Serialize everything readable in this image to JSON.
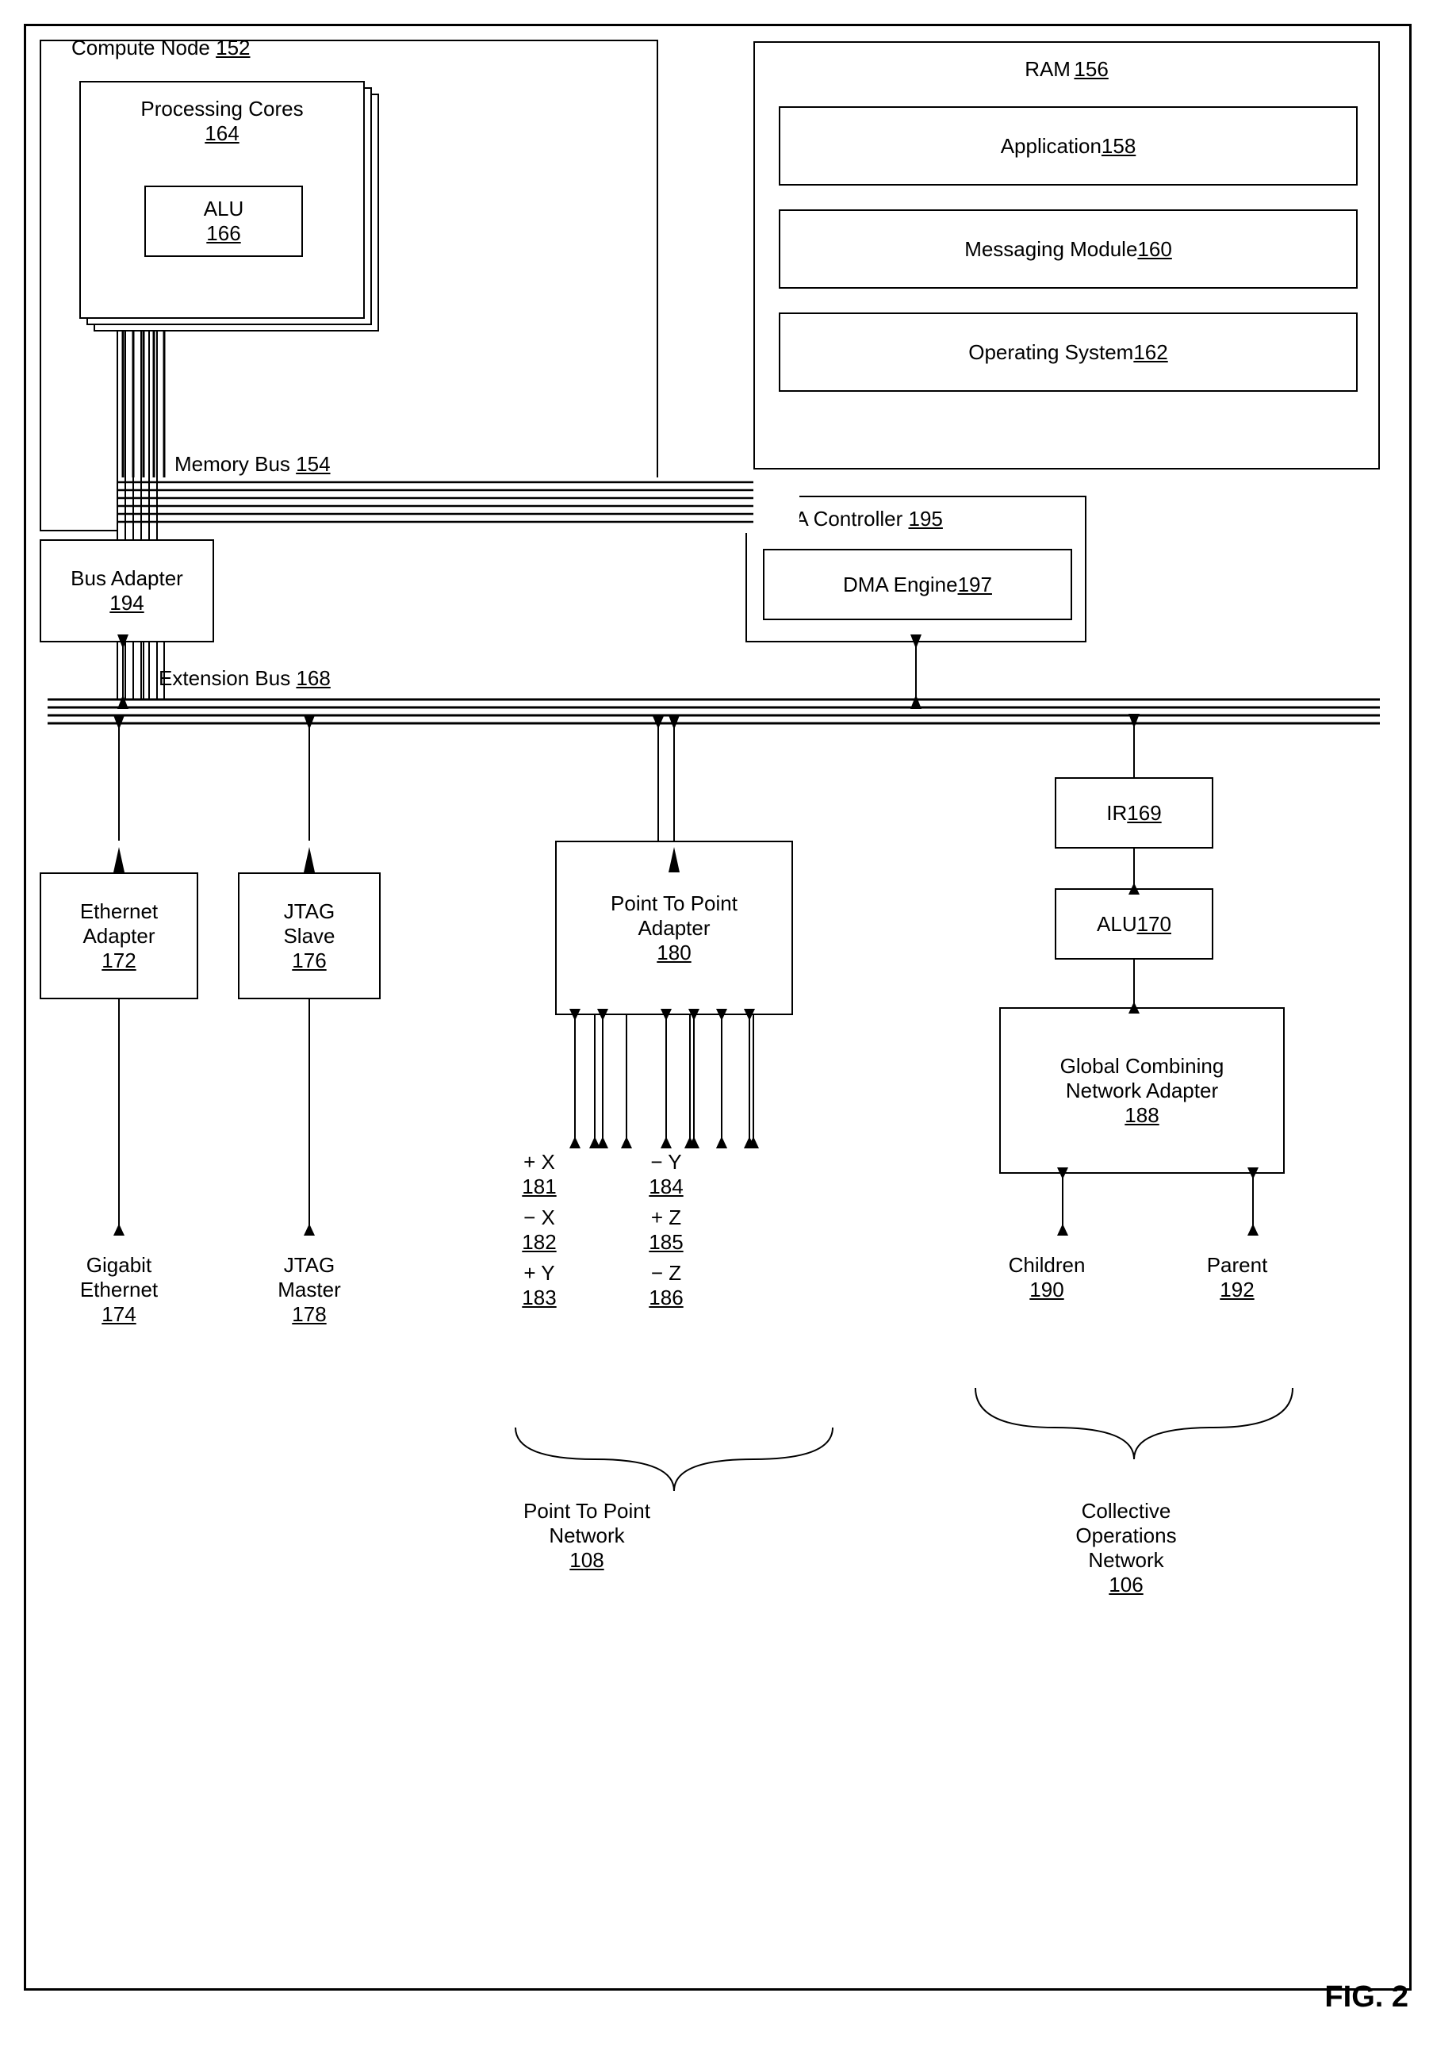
{
  "diagram": {
    "title": "FIG. 2",
    "compute_node": {
      "label": "Compute Node",
      "ref": "152",
      "processing_cores": {
        "label": "Processing Cores",
        "ref": "164",
        "alu": {
          "label": "ALU",
          "ref": "166"
        }
      },
      "memory_bus": {
        "label": "Memory Bus",
        "ref": "154"
      },
      "bus_adapter": {
        "label": "Bus Adapter",
        "ref": "194"
      }
    },
    "ram": {
      "label": "RAM",
      "ref": "156",
      "application": {
        "label": "Application",
        "ref": "158"
      },
      "messaging_module": {
        "label": "Messaging Module",
        "ref": "160"
      },
      "operating_system": {
        "label": "Operating System",
        "ref": "162"
      }
    },
    "dma_controller": {
      "label": "DMA Controller",
      "ref": "195",
      "dma_engine": {
        "label": "DMA Engine",
        "ref": "197"
      }
    },
    "extension_bus": {
      "label": "Extension Bus",
      "ref": "168"
    },
    "ethernet_adapter": {
      "label": "Ethernet Adapter",
      "ref": "172"
    },
    "jtag_slave": {
      "label": "JTAG Slave",
      "ref": "176"
    },
    "ptp_adapter": {
      "label": "Point To Point Adapter",
      "ref": "180"
    },
    "ir": {
      "label": "IR",
      "ref": "169"
    },
    "alu170": {
      "label": "ALU",
      "ref": "170"
    },
    "gcna": {
      "label": "Global Combining Network Adapter",
      "ref": "188"
    },
    "gigabit_ethernet": {
      "label": "Gigabit Ethernet",
      "ref": "174"
    },
    "jtag_master": {
      "label": "JTAG Master",
      "ref": "178"
    },
    "ptp_ports": [
      {
        "label": "+ X",
        "ref": "181"
      },
      {
        "label": "- X",
        "ref": "182"
      },
      {
        "label": "+ Y",
        "ref": "183"
      },
      {
        "label": "- Y",
        "ref": "184"
      },
      {
        "label": "+ Z",
        "ref": "185"
      },
      {
        "label": "- Z",
        "ref": "186"
      }
    ],
    "children": {
      "label": "Children",
      "ref": "190"
    },
    "parent": {
      "label": "Parent",
      "ref": "192"
    },
    "ptp_network": {
      "label": "Point To Point Network",
      "ref": "108"
    },
    "collective_ops_network": {
      "label": "Collective Operations Network",
      "ref": "106"
    }
  }
}
